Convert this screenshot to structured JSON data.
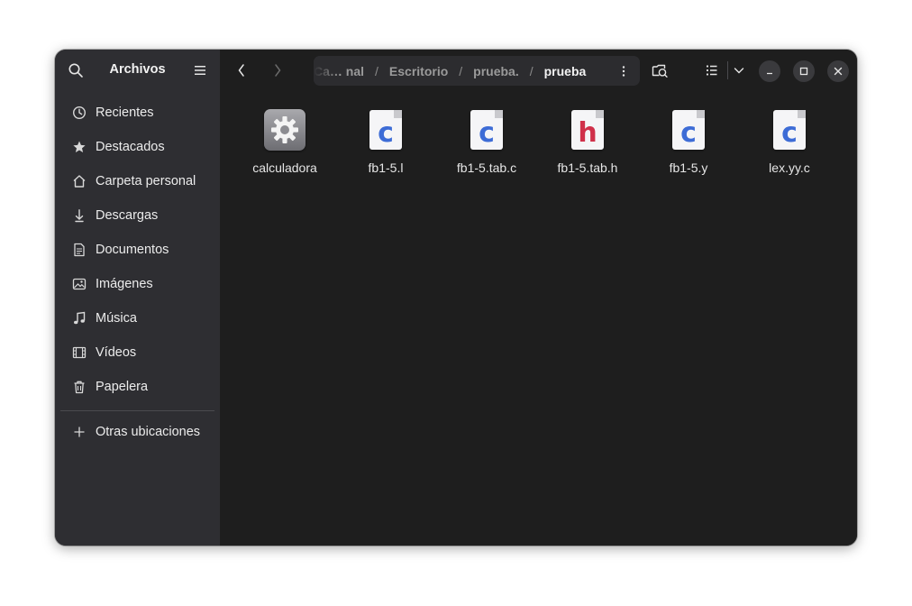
{
  "sidebar": {
    "title": "Archivos",
    "items": [
      {
        "label": "Recientes",
        "icon": "clock-icon"
      },
      {
        "label": "Destacados",
        "icon": "star-icon"
      },
      {
        "label": "Carpeta personal",
        "icon": "home-icon"
      },
      {
        "label": "Descargas",
        "icon": "download-icon"
      },
      {
        "label": "Documentos",
        "icon": "document-icon"
      },
      {
        "label": "Imágenes",
        "icon": "image-icon"
      },
      {
        "label": "Música",
        "icon": "music-icon"
      },
      {
        "label": "Vídeos",
        "icon": "video-icon"
      },
      {
        "label": "Papelera",
        "icon": "trash-icon"
      }
    ],
    "other": {
      "label": "Otras ubicaciones",
      "icon": "plus-icon"
    }
  },
  "pathbar": {
    "crumbs": [
      "Ca… nal",
      "Escritorio",
      "prueba.",
      "prueba"
    ],
    "separator": "/"
  },
  "files": [
    {
      "name": "calculadora",
      "type": "executable",
      "icon": "gear-icon"
    },
    {
      "name": "fb1-5.l",
      "type": "c",
      "letter": "c",
      "color": "#3d6cd6"
    },
    {
      "name": "fb1-5.tab.c",
      "type": "c",
      "letter": "c",
      "color": "#3d6cd6"
    },
    {
      "name": "fb1-5.tab.h",
      "type": "h",
      "letter": "h",
      "color": "#d0304a"
    },
    {
      "name": "fb1-5.y",
      "type": "c",
      "letter": "c",
      "color": "#3d6cd6"
    },
    {
      "name": "lex.yy.c",
      "type": "c",
      "letter": "c",
      "color": "#3d6cd6"
    }
  ],
  "colors": {
    "sidebar_bg": "#2e2e32",
    "content_bg": "#1e1e1e",
    "text": "#e8e8e8"
  }
}
